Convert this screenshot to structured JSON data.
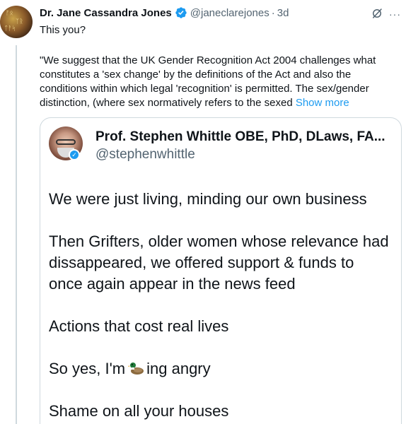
{
  "tweet": {
    "author_name": "Dr. Jane Cassandra Jones",
    "handle": "@janeclarejones",
    "separator": "·",
    "time": "3d",
    "more": "···",
    "text": "This you?"
  },
  "quoted_passage": {
    "line1": "\"We suggest that the UK Gender Recognition Act 2004 challenges what",
    "line2": "constitutes a 'sex change' by the definitions of the Act and also the",
    "line3": "conditions within which legal 'recognition' is permitted. The sex/gender",
    "line4": "distinction, (where sex normatively refers to the sexed",
    "show_more": "Show more"
  },
  "quote_tweet": {
    "author_name": "Prof. Stephen Whittle OBE, PhD, DLaws, FA...",
    "handle": "@stephenwhittle",
    "p1": "We were just living, minding our own business",
    "p2_line1": "Then Grifters, older women whose relevance had",
    "p2_line2": "dissappeared, we offered support & funds to",
    "p2_line3": "once again appear in the news feed",
    "p3": "Actions that cost real lives",
    "p4_before": "So yes, I'm",
    "p4_after": "ing angry",
    "p5": "Shame on all your houses"
  },
  "colors": {
    "text": "#0f1419",
    "secondary": "#536471",
    "link": "#1d9bf0",
    "verified": "#1d9bf0",
    "border": "#cfd9de"
  },
  "icons": {
    "verified": "verified-badge-icon",
    "grok": "grok-icon",
    "more": "more-icon",
    "duck": "duck-emoji-icon"
  }
}
